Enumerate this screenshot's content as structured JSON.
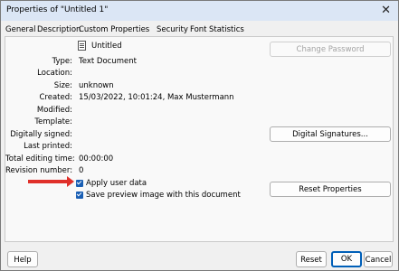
{
  "window": {
    "title": "Properties of \"Untitled 1\"",
    "close": "✕"
  },
  "tabs": [
    "General",
    "Description",
    "Custom Properties",
    "Security",
    "Font",
    "Statistics"
  ],
  "doc": {
    "name": "Untitled"
  },
  "fields": [
    {
      "label": "Type:",
      "value": "Text Document"
    },
    {
      "label": "Location:",
      "value": ""
    },
    {
      "label": "Size:",
      "value": "unknown"
    },
    {
      "label": "Created:",
      "value": "15/03/2022, 10:01:24, Max Mustermann"
    },
    {
      "label": "Modified:",
      "value": ""
    },
    {
      "label": "Template:",
      "value": ""
    },
    {
      "label": "Digitally signed:",
      "value": ""
    },
    {
      "label": "Last printed:",
      "value": ""
    },
    {
      "label": "Total editing time:",
      "value": "00:00:00"
    },
    {
      "label": "Revision number:",
      "value": "0"
    }
  ],
  "buttons": {
    "change_password": "Change Password",
    "digital_signatures": "Digital Signatures...",
    "reset_properties": "Reset Properties",
    "help": "Help",
    "reset": "Reset",
    "ok": "OK",
    "cancel": "Cancel"
  },
  "checkboxes": {
    "apply_user_data": {
      "label": "Apply user data",
      "checked": true
    },
    "save_preview": {
      "label": "Save preview image with this document",
      "checked": true
    }
  },
  "colors": {
    "accent": "#005fb8",
    "annotation_arrow": "#e0302a",
    "checkbox": "#1a5fb4"
  }
}
